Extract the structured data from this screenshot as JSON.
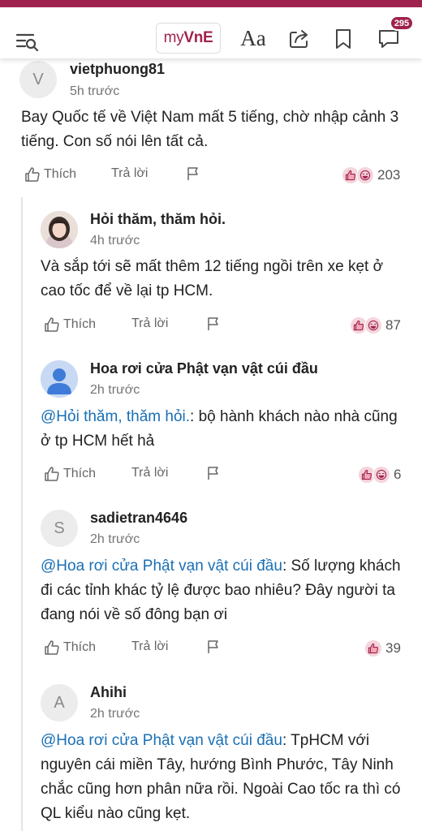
{
  "header": {
    "brand_my": "my",
    "brand_vne": "VnE",
    "font_label": "Aa",
    "notification_count": "295",
    "icons": [
      "menu-search-icon",
      "share-icon",
      "bookmark-icon",
      "comment-icon"
    ]
  },
  "actions": {
    "like_label": "Thích",
    "reply_label": "Trả lời"
  },
  "comments": [
    {
      "avatar_letter": "V",
      "name": "vietphuong81",
      "time": "5h trước",
      "text": "Bay Quốc tế về Việt Nam mất 5 tiếng, chờ nhập cảnh 3 tiếng. Con số nói lên tất cả.",
      "reaction_count": "203"
    },
    {
      "avatar_letter": "",
      "name": "Hỏi thăm, thăm hỏi.",
      "time": "4h trước",
      "text": "Và sắp tới sẽ mất thêm 12 tiếng ngồi trên xe kẹt ở cao tốc để về lại tp HCM.",
      "reaction_count": "87"
    },
    {
      "avatar_letter": "",
      "name": "Hoa rơi cửa Phật vạn vật cúi đầu",
      "time": "2h trước",
      "mention": "@Hỏi thăm, thăm hỏi.",
      "text": ": bộ hành khách nào nhà cũng ở tp HCM hết hả",
      "reaction_count": "6"
    },
    {
      "avatar_letter": "S",
      "name": "sadietran4646",
      "time": "2h trước",
      "mention": "@Hoa rơi cửa Phật vạn vật cúi đầu",
      "text": ": Số lượng khách đi các tỉnh khác tỷ lệ được bao nhiêu? Đây người ta đang nói về số đông bạn ơi",
      "reaction_count": "39"
    },
    {
      "avatar_letter": "A",
      "name": "Ahihi",
      "time": "2h trước",
      "mention": "@Hoa rơi cửa Phật vạn vật cúi đầu",
      "text": ": TpHCM với nguyên cái miền Tây, hướng Bình Phước, Tây Ninh chắc cũng hơn phân nữa rồi. Ngoài Cao tốc ra thì có QL kiểu nào cũng kẹt."
    }
  ],
  "colors": {
    "brand": "#9f224e",
    "mention": "#1a6fb5",
    "reaction_bg": "#f5d5dc"
  }
}
